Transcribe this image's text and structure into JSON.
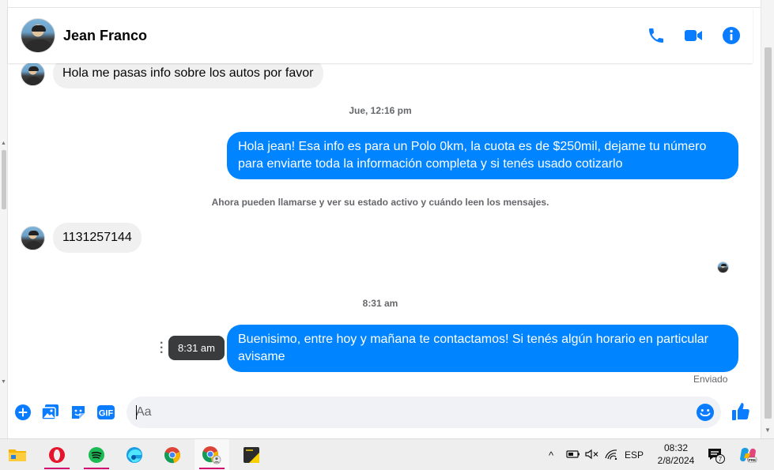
{
  "header": {
    "contact_name": "Jean Franco"
  },
  "messages": {
    "incoming_1": "Hola me pasas info sobre los autos por favor",
    "timestamp_1": "Jue, 12:16 pm",
    "outgoing_1_line1": "Hola jean! Esa info es para un Polo 0km, la cuota es de $250mil, dejame tu número",
    "outgoing_1_line2": "para enviarte toda la información completa y si tenés usado cotizarlo",
    "system_notice": "Ahora pueden llamarse y ver su estado activo y cuándo leen los mensajes.",
    "incoming_2": "1131257144",
    "timestamp_2": "8:31 am",
    "tooltip_time": "8:31 am",
    "outgoing_2_line1": "Buenisimo, entre hoy y mañana te contactamos! Si tenés algún horario en particular",
    "outgoing_2_line2": "avisame",
    "status": "Enviado"
  },
  "composer": {
    "placeholder": "Aa",
    "gif_label": "GIF"
  },
  "taskbar": {
    "language": "ESP",
    "time": "08:32",
    "date": "2/8/2024",
    "notification_count": "7"
  },
  "colors": {
    "accent": "#0084ff",
    "bubble_in": "#f0f0f0",
    "header_icons": "#0a7cff"
  }
}
